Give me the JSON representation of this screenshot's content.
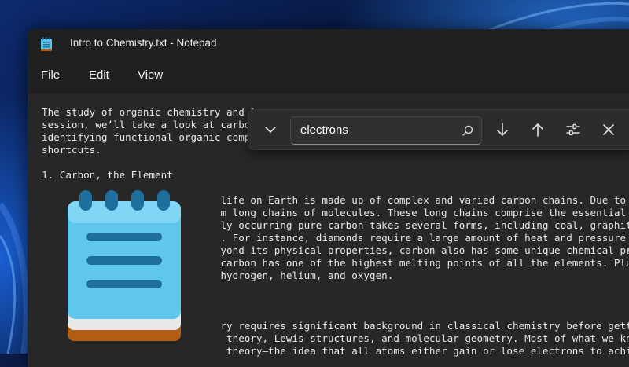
{
  "window": {
    "title": "Intro to Chemistry.txt - Notepad",
    "app_icon": "notepad-icon"
  },
  "menu": {
    "items": [
      {
        "label": "File"
      },
      {
        "label": "Edit"
      },
      {
        "label": "View"
      }
    ]
  },
  "editor": {
    "lines": [
      "The study of organic chemistry and l",
      "session, we’ll take a look at carbo",
      "identifying functional organic compo",
      "shortcuts.",
      "",
      "1. Carbon, the Element",
      "",
      "                              life on Earth is made up of complex and varied carbon chains. Due to its",
      "                              m long chains of molecules. These long chains comprise the essential bui",
      "                              ly occurring pure carbon takes several forms, including coal, graphite, a",
      "                              . For instance, diamonds require a large amount of heat and pressure to f",
      "                              yond its physical properties, carbon also has some unique chemical proper",
      "                              carbon has one of the highest melting points of all the elements. Plus,",
      "                              hydrogen, helium, and oxygen.",
      "",
      "",
      "",
      "                              ry requires significant background in classical chemistry before getting",
      "                               theory, Lewis structures, and molecular geometry. Most of what we know",
      "                               theory—the idea that all atoms either gain or lose electrons to achieve"
    ]
  },
  "find": {
    "value": "electrons",
    "icons": {
      "collapse": "chevron-down-icon",
      "search": "search-icon",
      "next": "arrow-down-icon",
      "previous": "arrow-up-icon",
      "options": "sliders-icon",
      "close": "close-icon"
    }
  },
  "colors": {
    "window_bg": "#272727",
    "titlebar_bg": "#202020",
    "findbar_bg": "#2c2c2c",
    "logo_light_blue": "#5fc6ec",
    "logo_dark_blue": "#1f6f9e",
    "logo_orange": "#b25c14"
  }
}
